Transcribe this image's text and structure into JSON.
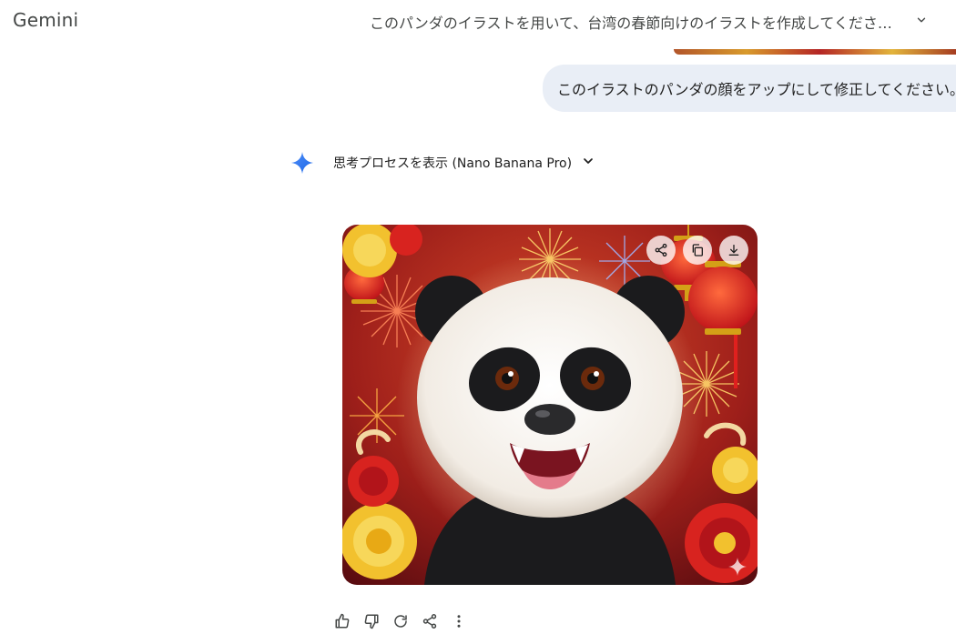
{
  "app": {
    "name": "Gemini"
  },
  "conversation": {
    "title": "このパンダのイラストを用いて、台湾の春節向けのイラストを作成してくださ…",
    "user_message": "このイラストのパンダの顔をアップにして修正してください。"
  },
  "response": {
    "thoughts_label": "思考プロセスを表示 (Nano Banana Pro)",
    "image_subject": "panda with fireworks, lanterns and peonies"
  },
  "icons": {
    "title_chevron": "chevron-down-icon",
    "spark": "gemini-spark-icon",
    "thoughts_chevron": "chevron-down-icon",
    "image_share": "share-icon",
    "image_copy": "copy-icon",
    "image_download": "download-icon",
    "watermark": "sparkle-icon",
    "thumbs_up": "thumbs-up-icon",
    "thumbs_down": "thumbs-down-icon",
    "regenerate": "refresh-icon",
    "share": "share-icon",
    "more": "more-vertical-icon"
  },
  "colors": {
    "user_bubble": "#e9eef6",
    "spark_blue": "#4285f4",
    "text_primary": "#1f1f1f",
    "text_secondary": "#444746"
  }
}
